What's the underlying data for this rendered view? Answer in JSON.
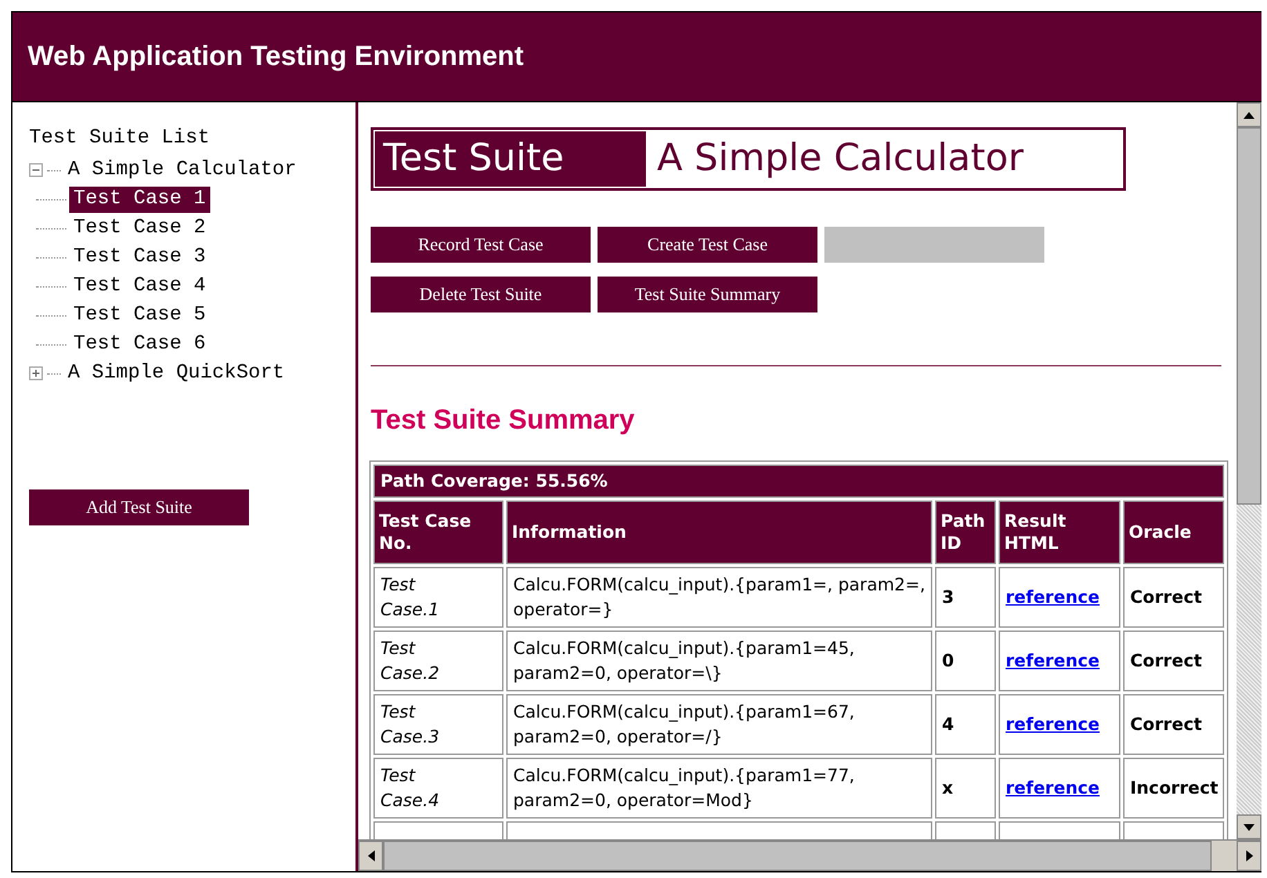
{
  "window": {
    "title": "Web Application Testing Environment"
  },
  "sidebar": {
    "heading": "Test Suite List",
    "tree": [
      {
        "label": "A Simple Calculator",
        "expanded": true,
        "children": [
          {
            "label": "Test Case 1",
            "selected": true
          },
          {
            "label": "Test Case 2",
            "selected": false
          },
          {
            "label": "Test Case 3",
            "selected": false
          },
          {
            "label": "Test Case 4",
            "selected": false
          },
          {
            "label": "Test Case 5",
            "selected": false
          },
          {
            "label": "Test Case 6",
            "selected": false
          }
        ]
      },
      {
        "label": "A Simple QuickSort",
        "expanded": false
      }
    ],
    "button": "Add Test Suite"
  },
  "main": {
    "suite_label": "Test Suite",
    "suite_name": "A Simple Calculator",
    "buttons": [
      "Record Test Case",
      "Create Test Case",
      "Delete Test Suite",
      "Test Suite Summary"
    ],
    "summary_heading": "Test Suite Summary",
    "table": {
      "coverage": "Path Coverage: 55.56%",
      "columns": [
        "Test Case No.",
        "Information",
        "Path ID",
        "Result HTML",
        "Oracle"
      ],
      "rows": [
        {
          "case": "Test Case.1",
          "information": "Calcu.FORM(calcu_input).{param1=, param2=, operator=}",
          "path_id": "3",
          "result": "reference",
          "oracle": "Correct"
        },
        {
          "case": "Test Case.2",
          "information": "Calcu.FORM(calcu_input).{param1=45, param2=0, operator=\\}",
          "path_id": "0",
          "result": "reference",
          "oracle": "Correct"
        },
        {
          "case": "Test Case.3",
          "information": "Calcu.FORM(calcu_input).{param1=67, param2=0, operator=/}",
          "path_id": "4",
          "result": "reference",
          "oracle": "Correct"
        },
        {
          "case": "Test Case.4",
          "information": "Calcu.FORM(calcu_input).{param1=77, param2=0, operator=Mod}",
          "path_id": "x",
          "result": "reference",
          "oracle": "Incorrect"
        }
      ]
    }
  }
}
